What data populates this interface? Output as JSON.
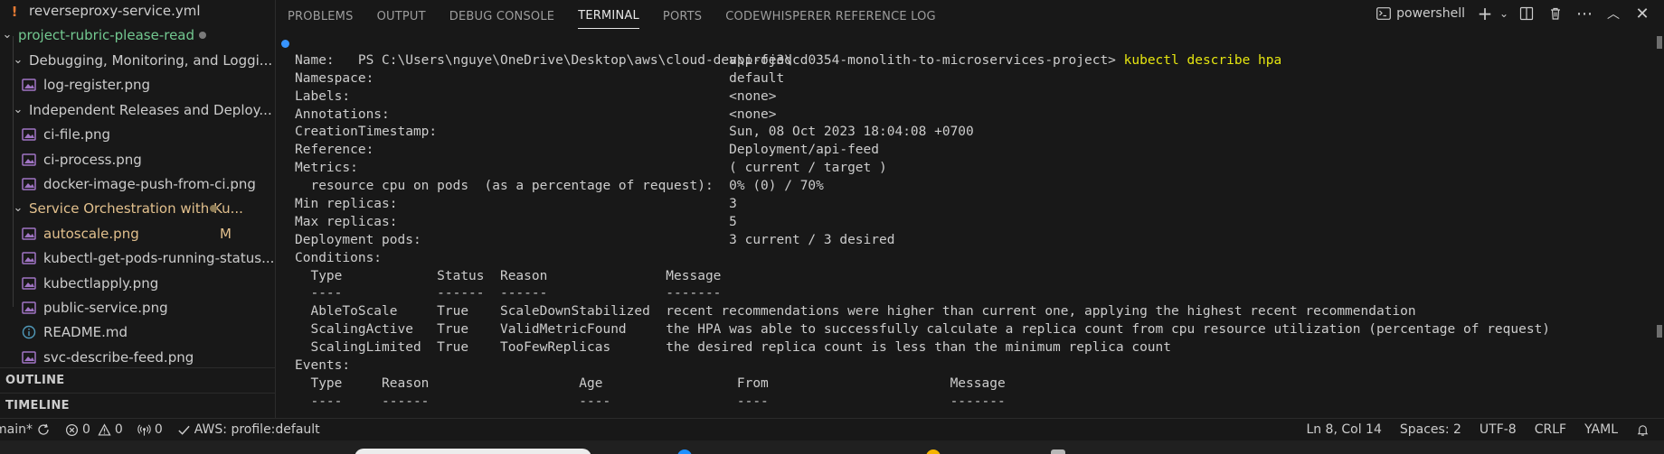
{
  "explorer": {
    "items": [
      {
        "label": "reverseproxy-service.yml",
        "kind": "yaml"
      },
      {
        "label": "project-rubric-please-read",
        "kind": "folder-green"
      },
      {
        "label": "Debugging, Monitoring, and Loggi...",
        "kind": "folder"
      },
      {
        "label": "log-register.png",
        "kind": "image"
      },
      {
        "label": "Independent Releases and Deploy...",
        "kind": "folder"
      },
      {
        "label": "ci-file.png",
        "kind": "image"
      },
      {
        "label": "ci-process.png",
        "kind": "image"
      },
      {
        "label": "docker-image-push-from-ci.png",
        "kind": "image"
      },
      {
        "label": "Service Orchestration with Ku...",
        "kind": "folder-yellow"
      },
      {
        "label": "autoscale.png",
        "kind": "image-modified",
        "badge": "M"
      },
      {
        "label": "kubectl-get-pods-running-status....",
        "kind": "image"
      },
      {
        "label": "kubectlapply.png",
        "kind": "image"
      },
      {
        "label": "public-service.png",
        "kind": "image"
      },
      {
        "label": "README.md",
        "kind": "info"
      },
      {
        "label": "svc-describe-feed.png",
        "kind": "image"
      }
    ],
    "outline_label": "OUTLINE",
    "timeline_label": "TIMELINE"
  },
  "panel": {
    "tabs": [
      "PROBLEMS",
      "OUTPUT",
      "DEBUG CONSOLE",
      "TERMINAL",
      "PORTS",
      "CODEWHISPERER REFERENCE LOG"
    ],
    "active_tab": "TERMINAL",
    "shell_label": "powershell"
  },
  "terminal": {
    "prompt": "PS C:\\Users\\nguye\\OneDrive\\Desktop\\aws\\cloud-dev\\proj3\\cd0354-monolith-to-microservices-project> ",
    "command": "kubectl describe hpa",
    "lines": [
      "Name:                                                  api-feed",
      "Namespace:                                             default",
      "Labels:                                                <none>",
      "Annotations:                                           <none>",
      "CreationTimestamp:                                     Sun, 08 Oct 2023 18:04:08 +0700",
      "Reference:                                             Deployment/api-feed",
      "Metrics:                                               ( current / target )",
      "  resource cpu on pods  (as a percentage of request):  0% (0) / 70%",
      "Min replicas:                                          3",
      "Max replicas:                                          5",
      "Deployment pods:                                       3 current / 3 desired",
      "Conditions:",
      "  Type            Status  Reason               Message",
      "  ----            ------  ------               -------",
      "  AbleToScale     True    ScaleDownStabilized  recent recommendations were higher than current one, applying the highest recent recommendation",
      "  ScalingActive   True    ValidMetricFound     the HPA was able to successfully calculate a replica count from cpu resource utilization (percentage of request)",
      "  ScalingLimited  True    TooFewReplicas       the desired replica count is less than the minimum replica count",
      "Events:",
      "  Type     Reason                   Age                 From                       Message",
      "  ----     ------                   ----                ----                       -------"
    ]
  },
  "statusbar": {
    "branch": "main*",
    "errors": "0",
    "warnings": "0",
    "ports": "0",
    "aws_profile": "AWS: profile:default",
    "cursor": "Ln 8, Col 14",
    "spaces": "Spaces: 2",
    "encoding": "UTF-8",
    "eol": "CRLF",
    "language": "YAML"
  },
  "colors": {
    "accent": "#3794ff",
    "command": "#e5e510",
    "folder_green": "#73c991",
    "modified": "#e2c08d"
  }
}
